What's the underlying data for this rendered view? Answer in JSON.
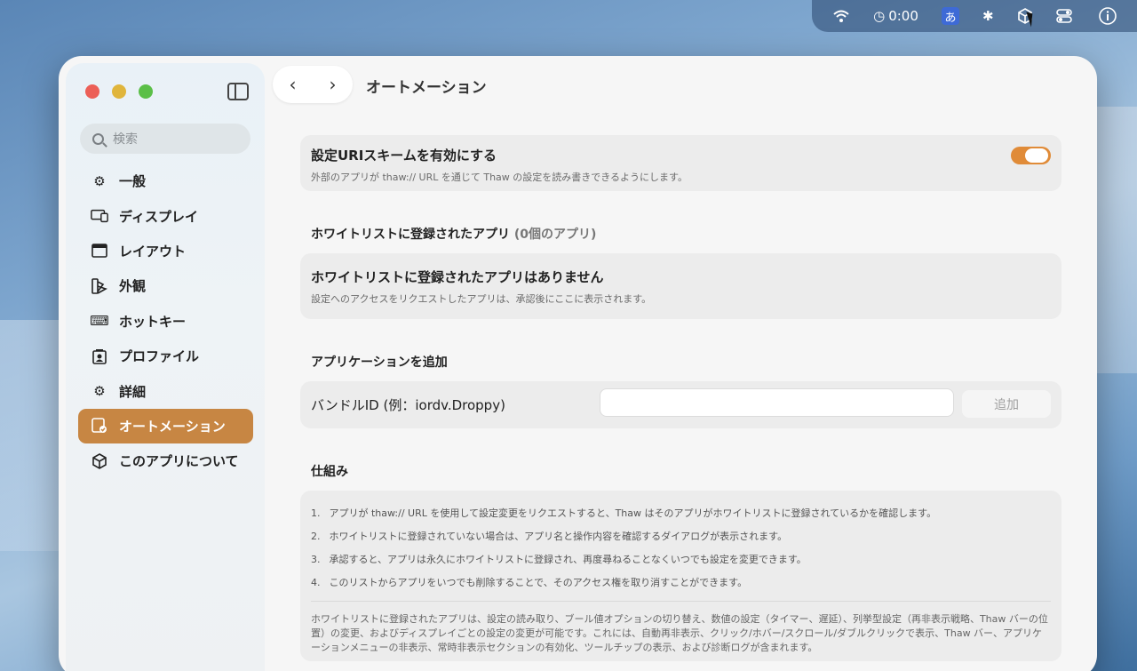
{
  "menubar": {
    "timer": "0:00",
    "ime": "あ"
  },
  "window": {
    "title": "オートメーション"
  },
  "sidebar": {
    "search_placeholder": "検索",
    "items": [
      {
        "label": "一般",
        "icon": "gear-icon"
      },
      {
        "label": "ディスプレイ",
        "icon": "display-icon"
      },
      {
        "label": "レイアウト",
        "icon": "layout-icon"
      },
      {
        "label": "外観",
        "icon": "appearance-icon"
      },
      {
        "label": "ホットキー",
        "icon": "keyboard-icon"
      },
      {
        "label": "プロファイル",
        "icon": "profile-icon"
      },
      {
        "label": "詳細",
        "icon": "gears-icon"
      },
      {
        "label": "オートメーション",
        "icon": "automation-icon"
      },
      {
        "label": "このアプリについて",
        "icon": "cube-icon"
      }
    ],
    "active_index": 7
  },
  "uri_scheme": {
    "title": "設定URIスキームを有効にする",
    "description": "外部のアプリが thaw:// URL を通じて Thaw の設定を読み書きできるようにします。",
    "enabled": true
  },
  "whitelist": {
    "heading": "ホワイトリストに登録されたアプリ",
    "count_label": "(0個のアプリ)",
    "empty_title": "ホワイトリストに登録されたアプリはありません",
    "empty_description": "設定へのアクセスをリクエストしたアプリは、承認後にここに表示されます。"
  },
  "add_app": {
    "heading": "アプリケーションを追加",
    "bundle_label": "バンドルID (例：iordv.Droppy)",
    "input_value": "",
    "add_button": "追加"
  },
  "how_it_works": {
    "heading": "仕組み",
    "steps": [
      {
        "num": "1.",
        "text": "アプリが thaw:// URL を使用して設定変更をリクエストすると、Thaw はそのアプリがホワイトリストに登録されているかを確認します。"
      },
      {
        "num": "2.",
        "text": "ホワイトリストに登録されていない場合は、アプリ名と操作内容を確認するダイアログが表示されます。"
      },
      {
        "num": "3.",
        "text": "承認すると、アプリは永久にホワイトリストに登録され、再度尋ねることなくいつでも設定を変更できます。"
      },
      {
        "num": "4.",
        "text": "このリストからアプリをいつでも削除することで、そのアクセス権を取り消すことができます。"
      }
    ],
    "note": "ホワイトリストに登録されたアプリは、設定の読み取り、ブール値オプションの切り替え、数値の設定（タイマー、遅延）、列挙型設定（再非表示戦略、Thaw バーの位置）の変更、およびディスプレイごとの設定の変更が可能です。これには、自動再非表示、クリック/ホバー/スクロール/ダブルクリックで表示、Thaw バー、アプリケーションメニューの非表示、常時非表示セクションの有効化、ツールチップの表示、および診断ログが含まれます。"
  },
  "colors": {
    "accent": "#c78643",
    "toggle_on": "#e08b38"
  }
}
